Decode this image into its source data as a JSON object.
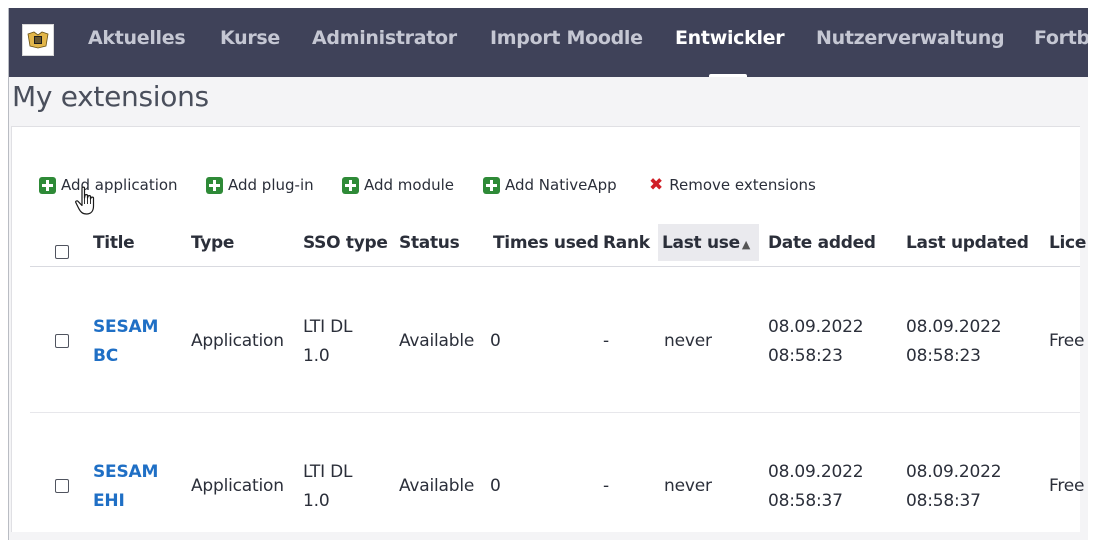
{
  "nav": {
    "items": [
      {
        "label": "Aktuelles",
        "active": false
      },
      {
        "label": "Kurse",
        "active": false
      },
      {
        "label": "Administrator",
        "active": false
      },
      {
        "label": "Import Moodle",
        "active": false
      },
      {
        "label": "Entwickler",
        "active": true
      },
      {
        "label": "Nutzerverwaltung",
        "active": false
      },
      {
        "label": "Fortb",
        "active": false
      }
    ],
    "logo_icon": "crest-logo-icon"
  },
  "page": {
    "title": "My extensions"
  },
  "toolbar": {
    "add_application": "Add application",
    "add_plugin": "Add plug-in",
    "add_module": "Add module",
    "add_nativeapp": "Add NativeApp",
    "remove_extensions": "Remove extensions",
    "add_icon": "plus-square-icon",
    "remove_icon": "close-icon"
  },
  "table": {
    "columns": [
      "Title",
      "Type",
      "SSO type",
      "Status",
      "Times used",
      "Rank",
      "Last use",
      "Date added",
      "Last updated",
      "Lice"
    ],
    "sorted_column": "Last use",
    "rows": [
      {
        "title_line1": "SESAM",
        "title_line2": "BC",
        "type": "Application",
        "sso_line1": "LTI DL",
        "sso_line2": "1.0",
        "status": "Available",
        "times_used": "0",
        "rank": "-",
        "last_used": "never",
        "date_added_line1": "08.09.2022",
        "date_added_line2": "08:58:23",
        "last_updated_line1": "08.09.2022",
        "last_updated_line2": "08:58:23",
        "license": "Free"
      },
      {
        "title_line1": "SESAM",
        "title_line2": "EHI",
        "type": "Application",
        "sso_line1": "LTI DL",
        "sso_line2": "1.0",
        "status": "Available",
        "times_used": "0",
        "rank": "-",
        "last_used": "never",
        "date_added_line1": "08.09.2022",
        "date_added_line2": "08:58:37",
        "last_updated_line1": "08.09.2022",
        "last_updated_line2": "08:58:37",
        "license": "Free"
      }
    ]
  },
  "colors": {
    "nav_bg": "#3f4259",
    "link": "#1f6fc5",
    "add_green": "#2e8a37",
    "remove_red": "#d01f27"
  }
}
